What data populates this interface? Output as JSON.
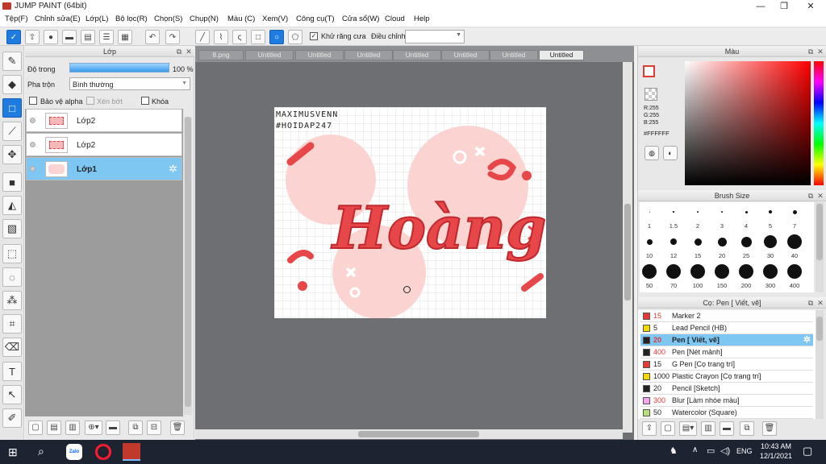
{
  "window": {
    "title": "JUMP PAINT (64bit)",
    "minimize": "—",
    "maximize": "❐",
    "close": "✕"
  },
  "menu": [
    "Tệp(F)",
    "Chỉnh sửa(E)",
    "Lớp(L)",
    "Bộ lọc(R)",
    "Chọn(S)",
    "Chụp(N)",
    "Màu (C)",
    "Xem(V)",
    "Công cụ(T)",
    "Cửa sổ(W)",
    "Cloud",
    "Help"
  ],
  "toolbar": {
    "antialias_label": "Khử răng cưa",
    "adjust_label": "Điều chỉnh",
    "adjust_value": ""
  },
  "layer_panel": {
    "title": "Lớp",
    "opacity_label": "Độ trong",
    "opacity_value": "100 %",
    "opacity_fraction": 1.0,
    "blend_label": "Pha trộn",
    "blend_value": "Bình thường",
    "protect_alpha": "Bảo vệ alpha",
    "clip": "Xén bớt",
    "lock": "Khóa",
    "layers": [
      {
        "name": "Lớp2",
        "selected": false
      },
      {
        "name": "Lớp2",
        "selected": false
      },
      {
        "name": "Lớp1",
        "selected": true
      }
    ]
  },
  "tabs": [
    {
      "label": "8.png",
      "selected": false
    },
    {
      "label": "Untitled",
      "selected": false
    },
    {
      "label": "Untitled",
      "selected": false
    },
    {
      "label": "Untitled",
      "selected": false
    },
    {
      "label": "Untitled",
      "selected": false
    },
    {
      "label": "Untitled",
      "selected": false
    },
    {
      "label": "Untitled",
      "selected": false
    },
    {
      "label": "Untitled",
      "selected": true
    }
  ],
  "artwork": {
    "signature_line1": "MAXIMUSVENN",
    "signature_line2": "#HOIDAP247",
    "main_word": "Hoàng"
  },
  "color_panel": {
    "title": "Màu",
    "r": "R:255",
    "g": "G:255",
    "b": "B:255",
    "hex": "#FFFFFF"
  },
  "brush_size_panel": {
    "title": "Brush Size",
    "sizes": [
      "1",
      "1.5",
      "2",
      "3",
      "4",
      "5",
      "7",
      "10",
      "12",
      "15",
      "20",
      "25",
      "30",
      "40",
      "50",
      "70",
      "100",
      "150",
      "200",
      "300",
      "400"
    ]
  },
  "brush_panel": {
    "title": "Cọ: Pen [ Viết, vẽ]",
    "brushes": [
      {
        "size": "15",
        "name": "Marker 2",
        "color": "#e53935",
        "size_color": "#e53935",
        "selected": false
      },
      {
        "size": "5",
        "name": "Lead Pencil (HB)",
        "color": "#f5d800",
        "size_color": "#222222",
        "selected": false
      },
      {
        "size": "20",
        "name": "Pen [ Viết, vẽ]",
        "color": "#222222",
        "size_color": "#e53935",
        "selected": true
      },
      {
        "size": "400",
        "name": "Pen [Nét mảnh]",
        "color": "#222222",
        "size_color": "#e53935",
        "selected": false
      },
      {
        "size": "15",
        "name": "G Pen [Cọ trang trí]",
        "color": "#e53935",
        "size_color": "#222222",
        "selected": false
      },
      {
        "size": "1000",
        "name": "Plastic Crayon [Cọ trang trí]",
        "color": "#f5d800",
        "size_color": "#222222",
        "selected": false
      },
      {
        "size": "20",
        "name": "Pencil [Sketch]",
        "color": "#222222",
        "size_color": "#222222",
        "selected": false
      },
      {
        "size": "300",
        "name": "Blur [Làm nhòe màu]",
        "color": "#f6a3f3",
        "size_color": "#e53935",
        "selected": false
      },
      {
        "size": "50",
        "name": "Watercolor (Square)",
        "color": "#b8e07a",
        "size_color": "#222222",
        "selected": false
      }
    ]
  },
  "taskbar": {
    "zalo": "Zalo",
    "lang": "ENG",
    "time": "10:43 AM",
    "date": "12/1/2021"
  }
}
